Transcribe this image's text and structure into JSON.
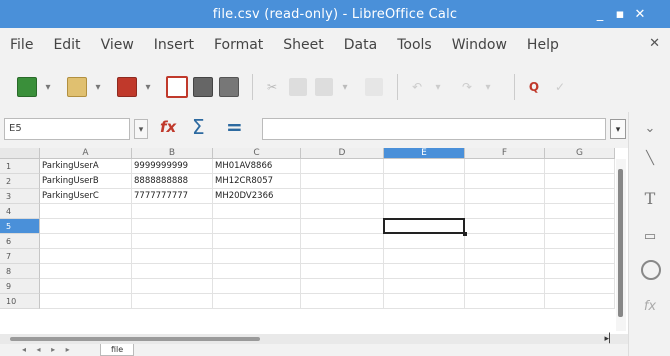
{
  "window": {
    "title": "file.csv (read-only) - LibreOffice Calc",
    "controls": [
      "_",
      "▪",
      "✕"
    ]
  },
  "menu": [
    "File",
    "Edit",
    "View",
    "Insert",
    "Format",
    "Sheet",
    "Data",
    "Tools",
    "Window",
    "Help"
  ],
  "menu_close": "✕",
  "formula": {
    "namebox": "E5",
    "fx": "fx",
    "sigma": "Σ",
    "equals": "=",
    "content": ""
  },
  "columns": [
    "A",
    "B",
    "C",
    "D",
    "E",
    "F",
    "G"
  ],
  "selected_column": "E",
  "rows": [
    "1",
    "2",
    "3",
    "4",
    "5",
    "6",
    "7",
    "8",
    "9",
    "10"
  ],
  "selected_row": "5",
  "cells": [
    [
      "ParkingUserA",
      "9999999999",
      "MH01AV8866"
    ],
    [
      "ParkingUserB",
      "8888888888",
      "MH12CR8057"
    ],
    [
      "ParkingUserC",
      "7777777777",
      "MH20DV2366"
    ]
  ],
  "sheet_tab": "file",
  "tab_nav": "◂ ◂ ▸ ▸",
  "colors": {
    "accent": "#4a90d9",
    "titlebar": "#4a90d9"
  }
}
